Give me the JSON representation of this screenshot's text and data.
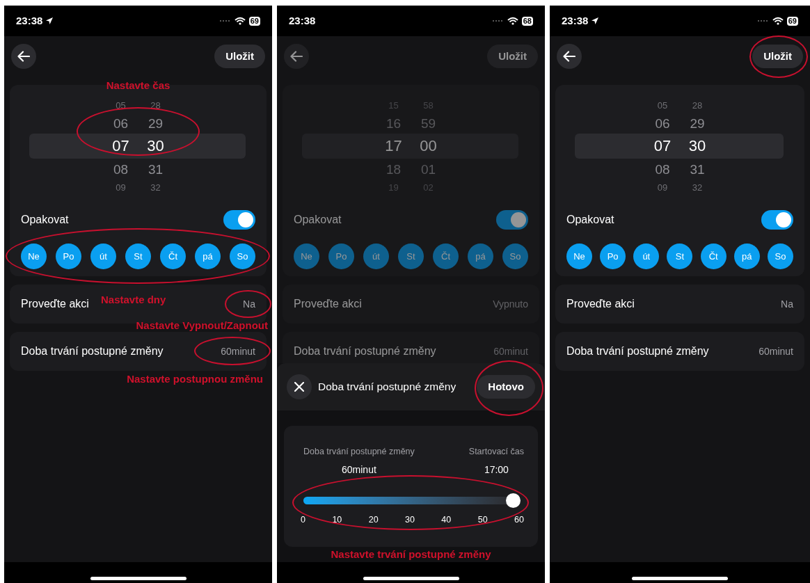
{
  "screens": [
    {
      "status": {
        "time": "23:38",
        "location": true,
        "battery": "69"
      },
      "save": {
        "label": "Uložit"
      },
      "picker": {
        "hours": [
          "05",
          "06",
          "07",
          "08",
          "09"
        ],
        "minutes": [
          "28",
          "29",
          "30",
          "31",
          "32"
        ],
        "circled": true,
        "note": "Nastavte čas"
      },
      "repeat": {
        "label": "Opakovat",
        "on": true
      },
      "days": [
        {
          "label": "Ne",
          "selected": true
        },
        {
          "label": "Po",
          "selected": true
        },
        {
          "label": "út",
          "selected": true
        },
        {
          "label": "St",
          "selected": true
        },
        {
          "label": "Čt",
          "selected": true
        },
        {
          "label": "pá",
          "selected": true
        },
        {
          "label": "So",
          "selected": true
        }
      ],
      "days_circled": true,
      "days_note": "Nastavte dny",
      "rows": [
        {
          "label": "Proveďte akci",
          "value": "Na",
          "circled": true,
          "note": "Nastavte Vypnout/Zapnout"
        },
        {
          "label": "Doba trvání postupné změny",
          "value": "60minut",
          "circled": true,
          "note": "Nastavte postupnou změnu"
        }
      ]
    },
    {
      "status": {
        "time": "23:38",
        "battery": "68"
      },
      "save": {
        "label": "Uložit"
      },
      "dimmed": true,
      "picker": {
        "hours": [
          "15",
          "16",
          "17",
          "18",
          "19"
        ],
        "minutes": [
          "58",
          "59",
          "00",
          "01",
          "02"
        ]
      },
      "repeat": {
        "label": "Opakovat",
        "on": true
      },
      "days": [
        {
          "label": "Ne",
          "selected": true
        },
        {
          "label": "Po",
          "selected": true
        },
        {
          "label": "út",
          "selected": true
        },
        {
          "label": "St",
          "selected": true
        },
        {
          "label": "Čt",
          "selected": true
        },
        {
          "label": "pá",
          "selected": true
        },
        {
          "label": "So",
          "selected": true
        }
      ],
      "rows": [
        {
          "label": "Proveďte akci",
          "value": "Vypnuto"
        },
        {
          "label": "Doba trvání postupné změny",
          "value": "60minut"
        }
      ],
      "sheet": {
        "title": "Doba trvání postupné změny",
        "done": "Hotovo",
        "done_circled": true,
        "duration_label": "Doba trvání postupné změny",
        "duration_value": "60minut",
        "start_label": "Startovací čas",
        "start_value": "17:00",
        "level": 1,
        "ticks": [
          "0",
          "10",
          "20",
          "30",
          "40",
          "50",
          "60"
        ],
        "slider_circled": true,
        "note": "Nastavte trvání postupné změny"
      }
    },
    {
      "status": {
        "time": "23:38",
        "location": true,
        "battery": "69"
      },
      "save": {
        "label": "Uložit",
        "circled": true
      },
      "picker": {
        "hours": [
          "05",
          "06",
          "07",
          "08",
          "09"
        ],
        "minutes": [
          "28",
          "29",
          "30",
          "31",
          "32"
        ]
      },
      "repeat": {
        "label": "Opakovat",
        "on": true
      },
      "days": [
        {
          "label": "Ne",
          "selected": true
        },
        {
          "label": "Po",
          "selected": true
        },
        {
          "label": "út",
          "selected": true
        },
        {
          "label": "St",
          "selected": true
        },
        {
          "label": "Čt",
          "selected": true
        },
        {
          "label": "pá",
          "selected": true
        },
        {
          "label": "So",
          "selected": true
        }
      ],
      "rows": [
        {
          "label": "Proveďte akci",
          "value": "Na"
        },
        {
          "label": "Doba trvání postupné změny",
          "value": "60minut"
        }
      ]
    }
  ]
}
